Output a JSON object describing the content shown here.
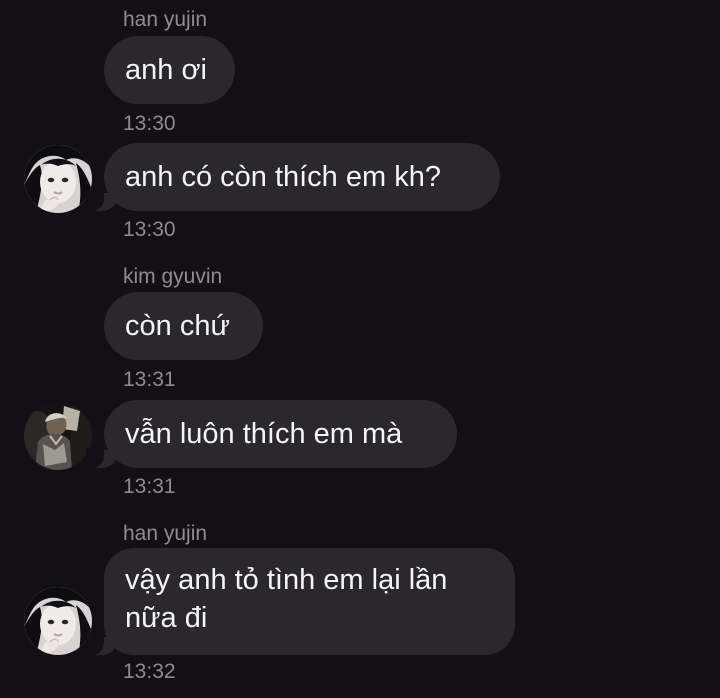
{
  "conversation": [
    {
      "sender": "han yujin",
      "bubbles": [
        {
          "text": "anh ơi",
          "time": "13:30"
        },
        {
          "text": "anh có còn thích em kh?",
          "time": "13:30",
          "avatar": "han-yujin-avatar"
        }
      ]
    },
    {
      "sender": "kim gyuvin",
      "bubbles": [
        {
          "text": "còn chứ",
          "time": "13:31"
        },
        {
          "text": "vẫn luôn thích em mà",
          "time": "13:31",
          "avatar": "kim-gyuvin-avatar"
        }
      ]
    },
    {
      "sender": "han yujin",
      "bubbles": [
        {
          "text": "vậy anh tỏ tình em lại lần nữa đi",
          "text_lines": [
            "vậy anh tỏ tình em lại lần",
            "nữa đi"
          ],
          "time": "13:32",
          "avatar": "han-yujin-avatar"
        }
      ]
    }
  ],
  "colors": {
    "background": "#120f16",
    "bubble": "#2a272d",
    "message_text": "#f4f4f5",
    "meta_text": "#8e8b93"
  }
}
